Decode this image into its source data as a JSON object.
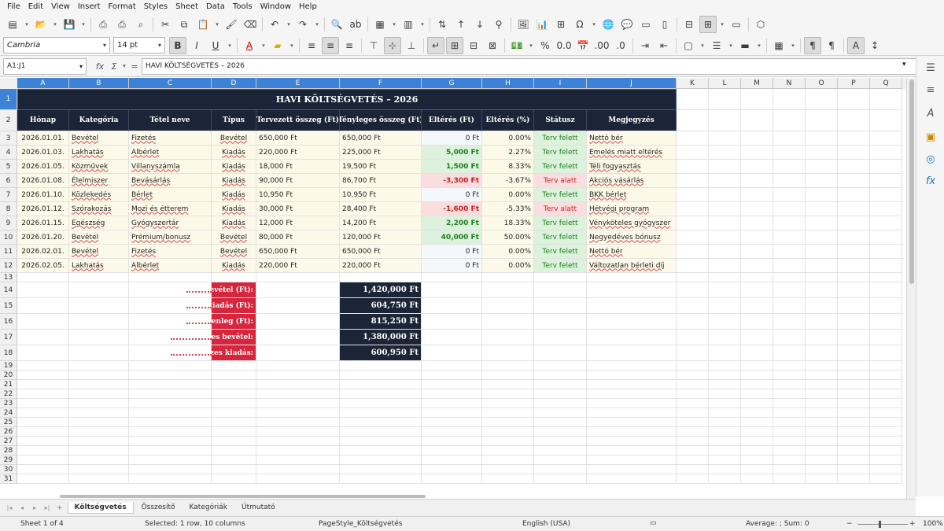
{
  "menu": [
    "File",
    "Edit",
    "View",
    "Insert",
    "Format",
    "Styles",
    "Sheet",
    "Data",
    "Tools",
    "Window",
    "Help"
  ],
  "font": {
    "name": "Cambria",
    "size": "14 pt"
  },
  "formula": {
    "cell_ref": "A1:J1",
    "content": "HAVI KÖLTSÉGVETÉS – 2026"
  },
  "columns": [
    "A",
    "B",
    "C",
    "D",
    "E",
    "F",
    "G",
    "H",
    "I",
    "J",
    "K",
    "L",
    "M",
    "N",
    "O",
    "P",
    "Q"
  ],
  "rows": [
    "1",
    "2",
    "3",
    "4",
    "5",
    "6",
    "7",
    "8",
    "9",
    "10",
    "11",
    "12",
    "13",
    "14",
    "15",
    "16",
    "17",
    "18",
    "19",
    "20",
    "21",
    "22",
    "23",
    "24",
    "25",
    "26",
    "27",
    "28",
    "29",
    "30",
    "31"
  ],
  "sheet_title": "HAVI KÖLTSÉGVETÉS – 2026",
  "headers": [
    "Hónap",
    "Kategória",
    "Tétel neve",
    "Típus",
    "Tervezett összeg (Ft)",
    "Tényleges összeg (Ft)",
    "Eltérés (Ft)",
    "Eltérés (%)",
    "Státusz",
    "Megjegyzés"
  ],
  "table_rows": [
    {
      "date": "2026.01.01.",
      "category": "Bevétel",
      "item": "Fizetés",
      "type": "Bevétel",
      "planned": "650,000 Ft",
      "actual": "650,000 Ft",
      "diff": "0 Ft",
      "diff_kind": "zero",
      "pct": "0.00%",
      "status": "Terv felett",
      "status_kind": "ok",
      "note": "Nettó bér"
    },
    {
      "date": "2026.01.03.",
      "category": "Lakhatás",
      "item": "Albérlet",
      "type": "Kiadás",
      "planned": "220,000 Ft",
      "actual": "225,000 Ft",
      "diff": "5,000 Ft",
      "diff_kind": "pos",
      "pct": "2.27%",
      "status": "Terv felett",
      "status_kind": "ok",
      "note": "Emelés miatt eltérés"
    },
    {
      "date": "2026.01.05.",
      "category": "Közművek",
      "item": "Villanyszámla",
      "type": "Kiadás",
      "planned": "18,000 Ft",
      "actual": "19,500 Ft",
      "diff": "1,500 Ft",
      "diff_kind": "pos",
      "pct": "8.33%",
      "status": "Terv felett",
      "status_kind": "ok",
      "note": "Téli fogyasztás"
    },
    {
      "date": "2026.01.08.",
      "category": "Élelmiszer",
      "item": "Bevásárlás",
      "type": "Kiadás",
      "planned": "90,000 Ft",
      "actual": "86,700 Ft",
      "diff": "-3,300 Ft",
      "diff_kind": "neg",
      "pct": "-3.67%",
      "status": "Terv alatt",
      "status_kind": "bad",
      "note": "Akciós vásárlás"
    },
    {
      "date": "2026.01.10.",
      "category": "Közlekedés",
      "item": "Bérlet",
      "type": "Kiadás",
      "planned": "10,950 Ft",
      "actual": "10,950 Ft",
      "diff": "0 Ft",
      "diff_kind": "zero",
      "pct": "0.00%",
      "status": "Terv felett",
      "status_kind": "ok",
      "note": "BKK bérlet"
    },
    {
      "date": "2026.01.12.",
      "category": "Szórakozás",
      "item": "Mozi és étterem",
      "type": "Kiadás",
      "planned": "30,000 Ft",
      "actual": "28,400 Ft",
      "diff": "-1,600 Ft",
      "diff_kind": "neg",
      "pct": "-5.33%",
      "status": "Terv alatt",
      "status_kind": "bad",
      "note": "Hétvégi program"
    },
    {
      "date": "2026.01.15.",
      "category": "Egészség",
      "item": "Gyógyszertár",
      "type": "Kiadás",
      "planned": "12,000 Ft",
      "actual": "14,200 Ft",
      "diff": "2,200 Ft",
      "diff_kind": "pos",
      "pct": "18.33%",
      "status": "Terv felett",
      "status_kind": "ok",
      "note": "Vényköteles gyógyszer"
    },
    {
      "date": "2026.01.20.",
      "category": "Bevétel",
      "item": "Prémium/bonusz",
      "type": "Bevétel",
      "planned": "80,000 Ft",
      "actual": "120,000 Ft",
      "diff": "40,000 Ft",
      "diff_kind": "pos",
      "pct": "50.00%",
      "status": "Terv felett",
      "status_kind": "ok",
      "note": "Negyedéves bónusz"
    },
    {
      "date": "2026.02.01.",
      "category": "Bevétel",
      "item": "Fizetés",
      "type": "Bevétel",
      "planned": "650,000 Ft",
      "actual": "650,000 Ft",
      "diff": "0 Ft",
      "diff_kind": "zero",
      "pct": "0.00%",
      "status": "Terv felett",
      "status_kind": "ok",
      "note": "Nettó bér"
    },
    {
      "date": "2026.02.05.",
      "category": "Lakhatás",
      "item": "Albérlet",
      "type": "Kiadás",
      "planned": "220,000 Ft",
      "actual": "220,000 Ft",
      "diff": "0 Ft",
      "diff_kind": "zero",
      "pct": "0.00%",
      "status": "Terv felett",
      "status_kind": "ok",
      "note": "Változatlan bérleti díj"
    }
  ],
  "summary": [
    {
      "label": "bevétel (Ft):",
      "value": "1,420,000 Ft"
    },
    {
      "label": "kiadás (Ft):",
      "value": "604,750 Ft"
    },
    {
      "label": "zyenleg (Ft):",
      "value": "815,250 Ft"
    },
    {
      "label": "szes bevétel:",
      "value": "1,380,000 Ft"
    },
    {
      "label": "szes kiadás:",
      "value": "600,950 Ft"
    }
  ],
  "sheet_tabs": [
    "Költségvetés",
    "Összesítő",
    "Kategóriák",
    "Útmutató"
  ],
  "active_tab": 0,
  "status": {
    "sheet": "Sheet 1 of 4",
    "selection": "Selected: 1 row, 10 columns",
    "page_style": "PageStyle_Költségvetés",
    "language": "English (USA)",
    "sum": "Average: ; Sum: 0",
    "zoom": "100%"
  },
  "colors": {
    "header_bg": "#1b2537",
    "summary_label_bg": "#d6253c",
    "data_bg": "#fdf9e9",
    "pos_bg": "#dcf2dc",
    "neg_bg": "#fadedf",
    "selection": "#3d82d6"
  }
}
